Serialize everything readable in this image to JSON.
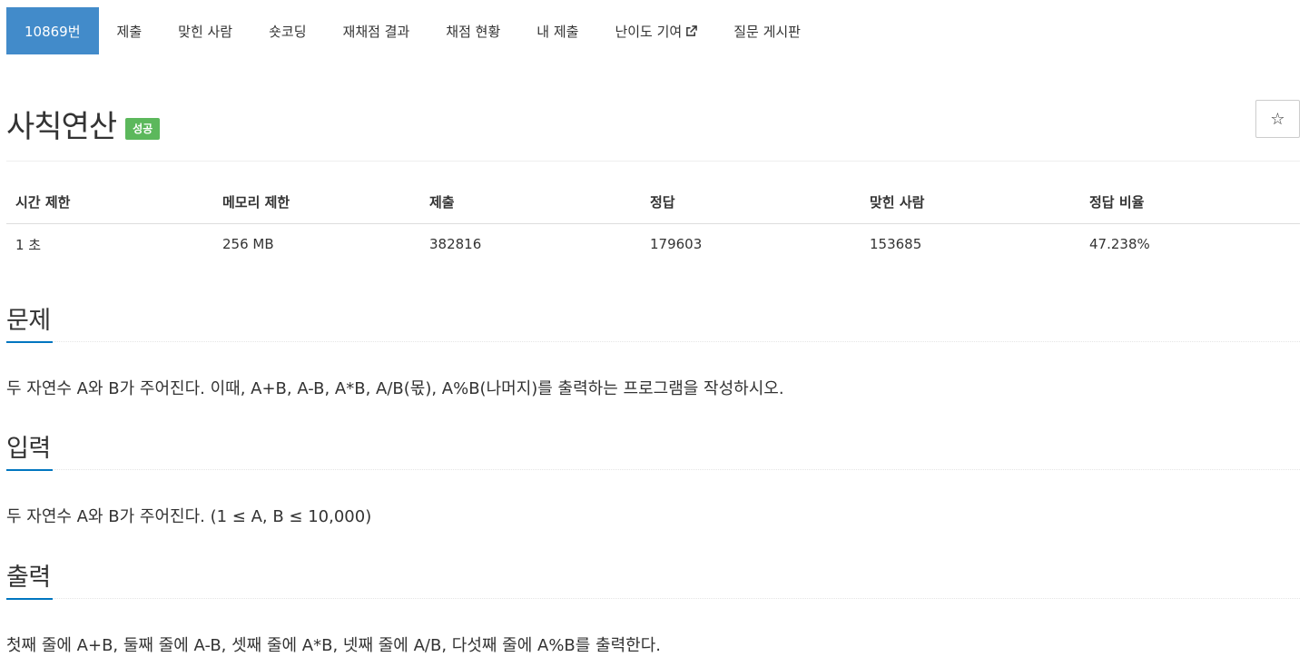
{
  "nav": {
    "problem_number": "10869번",
    "submit": "제출",
    "solved_people": "맞힌 사람",
    "short_coding": "숏코딩",
    "rejudge": "재채점 결과",
    "judge_status": "채점 현황",
    "my_submissions": "내 제출",
    "difficulty": "난이도 기여",
    "board": "질문 게시판"
  },
  "problem": {
    "title": "사칙연산",
    "status_badge": "성공",
    "star": "☆"
  },
  "info": {
    "headers": [
      "시간 제한",
      "메모리 제한",
      "제출",
      "정답",
      "맞힌 사람",
      "정답 비율"
    ],
    "values": [
      "1 초",
      "256 MB",
      "382816",
      "179603",
      "153685",
      "47.238%"
    ]
  },
  "sections": {
    "description_title": "문제",
    "description_text": "두 자연수 A와 B가 주어진다. 이때, A+B, A-B, A*B, A/B(몫), A%B(나머지)를 출력하는 프로그램을 작성하시오.",
    "input_title": "입력",
    "input_text": "두 자연수 A와 B가 주어진다. (1 ≤ A, B ≤ 10,000)",
    "output_title": "출력",
    "output_text": "첫째 줄에 A+B, 둘째 줄에 A-B, 셋째 줄에 A*B, 넷째 줄에 A/B, 다섯째 줄에 A%B를 출력한다."
  },
  "colors": {
    "active_tab": "#428bca",
    "badge_success": "#5cb85c",
    "headline_accent": "#0076c0"
  }
}
